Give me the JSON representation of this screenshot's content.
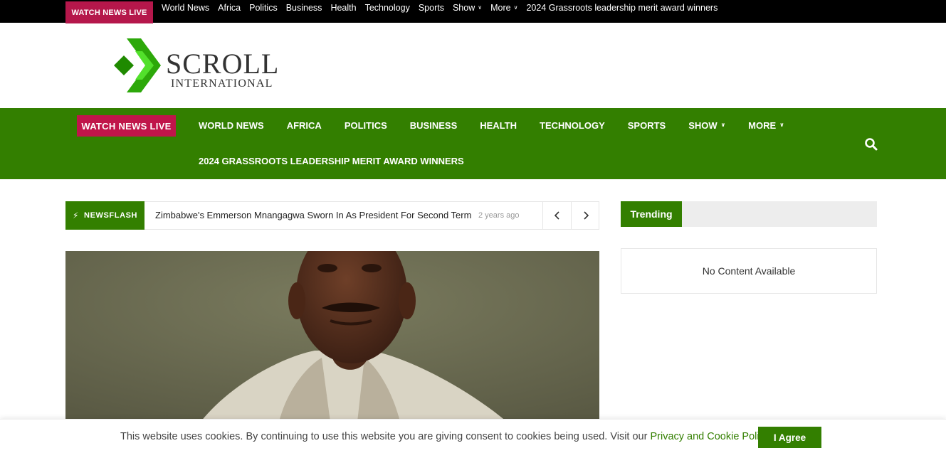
{
  "top_bar": {
    "live_label": "WATCH NEWS LIVE",
    "nav": [
      "World News",
      "Africa",
      "Politics",
      "Business",
      "Health",
      "Technology",
      "Sports"
    ],
    "show_label": "Show",
    "more_label": "More",
    "extra_link": "2024 Grassroots leadership merit award winners"
  },
  "logo": {
    "word": "SCROLL",
    "sub": "INTERNATIONAL",
    "colors": {
      "dark_green": "#1f8a00",
      "light_green": "#3fd21a"
    }
  },
  "main_nav": {
    "live_label": "WATCH NEWS LIVE",
    "items": [
      "WORLD NEWS",
      "AFRICA",
      "POLITICS",
      "BUSINESS",
      "HEALTH",
      "TECHNOLOGY",
      "SPORTS"
    ],
    "show_label": "SHOW",
    "more_label": "MORE",
    "extra_link": "2024 GRASSROOTS LEADERSHIP MERIT AWARD WINNERS",
    "search_icon": "search-icon"
  },
  "newsflash": {
    "label": "NEWSFLASH",
    "headline": "Zimbabwe's Emmerson Mnangagwa Sworn In As President For Second Term",
    "time": "2 years ago",
    "prev_icon": "chevron-left-icon",
    "next_icon": "chevron-right-icon"
  },
  "sidebar": {
    "trending_label": "Trending",
    "empty_text": "No Content Available"
  },
  "cookie": {
    "text": "This website uses cookies. By continuing to use this website you are giving consent to cookies being used. Visit our ",
    "link": "Privacy and Cookie Policy.",
    "button": "I Agree"
  },
  "colors": {
    "brand_green": "#337f00",
    "live_red": "#c0154a",
    "top_bar": "#000000"
  }
}
